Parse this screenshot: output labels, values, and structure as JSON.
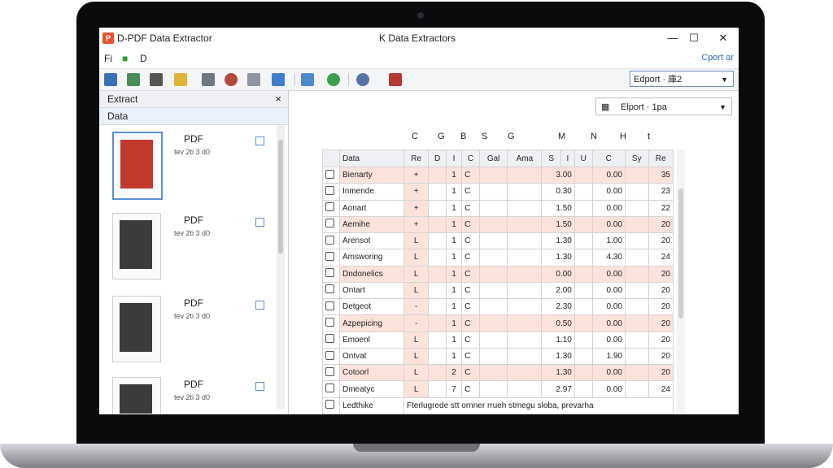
{
  "window": {
    "app_title": "D-PDF Data Extractor",
    "center_title": "K Data Extractors",
    "minimize": "—",
    "maximize": "☐",
    "close": "✕"
  },
  "menu": {
    "file": "Fi",
    "doc": "D",
    "export_link": "Cport ar"
  },
  "toolbar": {
    "export_select": "Edport · 庫2",
    "icons": [
      "open-icon",
      "save-icon",
      "print-icon",
      "clipboard-icon",
      "table-icon",
      "search-icon",
      "zoom-icon",
      "settings-icon",
      "preview-icon",
      "find-icon",
      "globe-icon",
      "export-icon"
    ]
  },
  "sidebar": {
    "header": "Extract",
    "close": "×",
    "sub_header": "Data",
    "items": [
      {
        "label": "PDF",
        "meta": "tev 2ti 3 d0"
      },
      {
        "label": "PDF",
        "meta": "tev 2ti 3 d0"
      },
      {
        "label": "PDF",
        "meta": "tev 2ti 3 d0"
      },
      {
        "label": "PDF",
        "meta": "tev 2ti 3 d0"
      }
    ]
  },
  "main": {
    "export_pages": "Elport · 1pa",
    "letters": [
      "C",
      "G",
      "B",
      "S",
      "G",
      "M",
      "N",
      "H",
      "t"
    ],
    "headers": [
      "Data",
      "Re",
      "D",
      "I",
      "C",
      "Gal",
      "Ama",
      "S",
      "I",
      "U",
      "C",
      "Sy",
      "Re"
    ],
    "rows": [
      {
        "name": "Bienarty",
        "b": "+",
        "c": "1",
        "d": "C",
        "v1": "3.00",
        "v2": "0.00",
        "v3": "35"
      },
      {
        "name": "Inmende",
        "b": "+",
        "c": "1",
        "d": "C",
        "v1": "0.30",
        "v2": "0.00",
        "v3": "23"
      },
      {
        "name": "Aonart",
        "b": "+",
        "c": "1",
        "d": "C",
        "v1": "1.50",
        "v2": "0.00",
        "v3": "22"
      },
      {
        "name": "Aemihe",
        "b": "+",
        "c": "1",
        "d": "C",
        "v1": "1.50",
        "v2": "0.00",
        "v3": "20"
      },
      {
        "name": "Arensot",
        "b": "L",
        "c": "1",
        "d": "C",
        "v1": "1.30",
        "v2": "1.00",
        "v3": "20"
      },
      {
        "name": "Amsworing",
        "b": "L",
        "c": "1",
        "d": "C",
        "v1": "1.30",
        "v2": "4.30",
        "v3": "24"
      },
      {
        "name": "Dndonelics",
        "b": "L",
        "c": "1",
        "d": "C",
        "v1": "0.00",
        "v2": "0.00",
        "v3": "20"
      },
      {
        "name": "Ontart",
        "b": "L",
        "c": "1",
        "d": "C",
        "v1": "2.00",
        "v2": "0.00",
        "v3": "20"
      },
      {
        "name": "Detgeot",
        "b": "-",
        "c": "1",
        "d": "C",
        "v1": "2.30",
        "v2": "0.00",
        "v3": "20"
      },
      {
        "name": "Azpepicing",
        "b": "-",
        "c": "1",
        "d": "C",
        "v1": "0.50",
        "v2": "0.00",
        "v3": "20"
      },
      {
        "name": "Emoenl",
        "b": "L",
        "c": "1",
        "d": "C",
        "v1": "1.10",
        "v2": "0.00",
        "v3": "20"
      },
      {
        "name": "Ontvat",
        "b": "L",
        "c": "1",
        "d": "C",
        "v1": "1.30",
        "v2": "1.90",
        "v3": "20"
      },
      {
        "name": "Cotoorl",
        "b": "L",
        "c": "2",
        "d": "C",
        "v1": "1.30",
        "v2": "0.00",
        "v3": "20"
      },
      {
        "name": "Dmeatyc",
        "b": "L",
        "c": "7",
        "d": "C",
        "v1": "2.97",
        "v2": "0.00",
        "v3": "24"
      },
      {
        "name": "Ledthike",
        "b": "Ftenlugrede stt",
        "c": "",
        "d": "",
        "v1": "",
        "v2": "",
        "v3": ""
      }
    ],
    "footer_text": "Fterlugrede stt ornner rrueh stmegu sloba, prevarha"
  }
}
